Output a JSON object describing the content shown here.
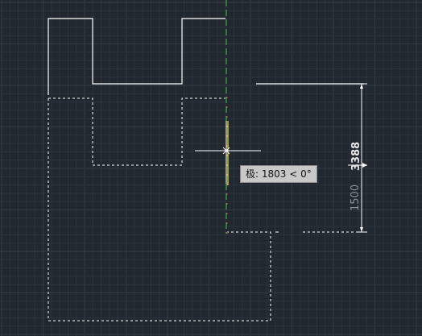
{
  "colors": {
    "background": "#212830",
    "grid_minor": "#2b333d",
    "grid_major": "#323b46",
    "geometry": "#ffffff",
    "tracking_green": "#3fbf3f",
    "tracking_red": "#d04545",
    "snap_yellow": "#e8ec3a"
  },
  "dimension": {
    "value_text": "1500",
    "edit_value_text": "3388"
  },
  "tooltip": {
    "prompt_text": "极: 1803 < 0°"
  }
}
